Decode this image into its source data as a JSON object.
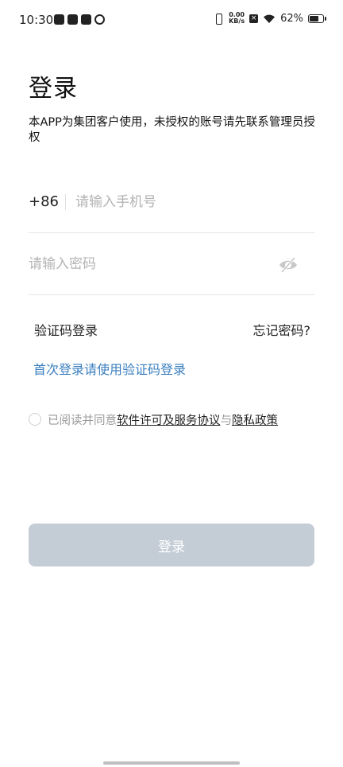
{
  "status_bar": {
    "time": "10:30",
    "net_speed_value": "0.00",
    "net_speed_unit": "KB/s",
    "battery_percent": "62%",
    "battery_level": 0.62
  },
  "page": {
    "title": "登录",
    "notice": "本APP为集团客户使用，未授权的账号请先联系管理员授权"
  },
  "phone": {
    "country_code": "+86",
    "placeholder": "请输入手机号"
  },
  "password": {
    "placeholder": "请输入密码"
  },
  "links": {
    "sms_login": "验证码登录",
    "forgot_password": "忘记密码?",
    "first_login_hint": "首次登录请使用验证码登录"
  },
  "agreement": {
    "prefix": "已阅读并同意",
    "license": "软件许可及服务协议",
    "and": "与",
    "privacy": "隐私政策",
    "checked": false
  },
  "login_button": {
    "label": "登录"
  },
  "colors": {
    "link_blue": "#3a7fbf",
    "button_disabled": "#c4ccd5"
  }
}
